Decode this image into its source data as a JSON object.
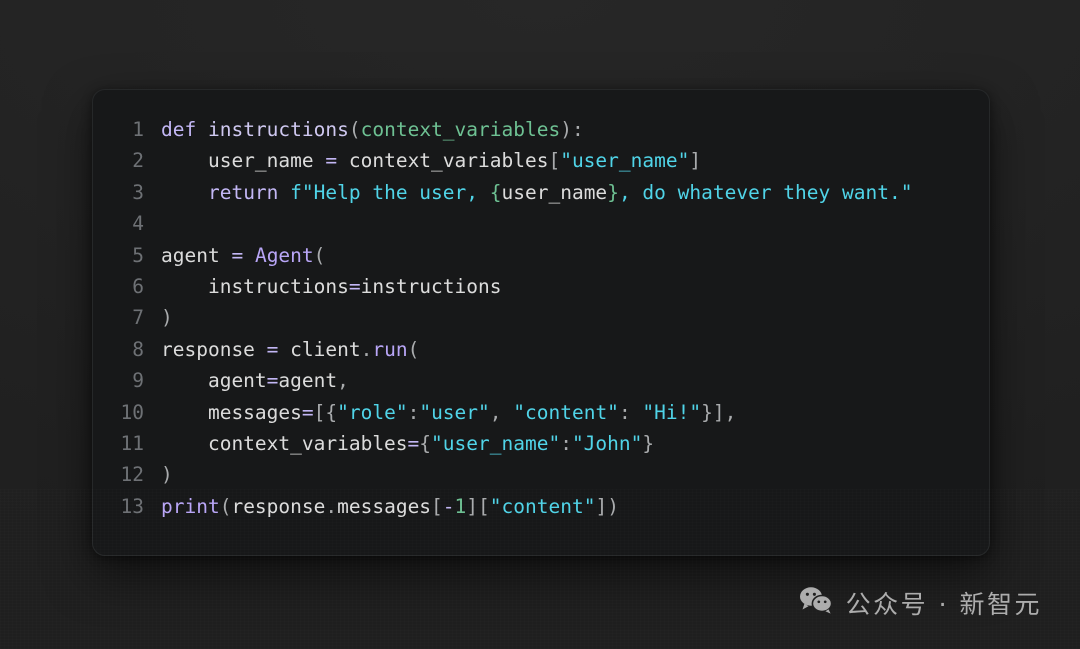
{
  "editor": {
    "language": "python",
    "card_background": "#171819",
    "page_background": "#242424",
    "line_count": 13,
    "lines": [
      {
        "number": "1",
        "text": "def instructions(context_variables):"
      },
      {
        "number": "2",
        "text": "    user_name = context_variables[\"user_name\"]"
      },
      {
        "number": "3",
        "text": "    return f\"Help the user, {user_name}, do whatever they want.\""
      },
      {
        "number": "4",
        "text": ""
      },
      {
        "number": "5",
        "text": "agent = Agent("
      },
      {
        "number": "6",
        "text": "    instructions=instructions"
      },
      {
        "number": "7",
        "text": ")"
      },
      {
        "number": "8",
        "text": "response = client.run("
      },
      {
        "number": "9",
        "text": "    agent=agent,"
      },
      {
        "number": "10",
        "text": "    messages=[{\"role\":\"user\", \"content\": \"Hi!\"}],"
      },
      {
        "number": "11",
        "text": "    context_variables={\"user_name\":\"John\"}"
      },
      {
        "number": "12",
        "text": ")"
      },
      {
        "number": "13",
        "text": "print(response.messages[-1][\"content\"])"
      }
    ],
    "line_numbers": [
      "1",
      "2",
      "3",
      "4",
      "5",
      "6",
      "7",
      "8",
      "9",
      "10",
      "11",
      "12",
      "13"
    ],
    "syntax_colors": {
      "keyword": "#c3b7f5",
      "function_def": "#cfc8f0",
      "function_call": "#b9a6f7",
      "parameter": "#6ec193",
      "string": "#50d4e8",
      "number": "#6ec193",
      "plain": "#dcdcdc",
      "punctuation": "#a9abad",
      "line_number": "#6e7175"
    }
  },
  "watermark": {
    "icon": "wechat-icon",
    "text": "公众号 · 新智元"
  }
}
